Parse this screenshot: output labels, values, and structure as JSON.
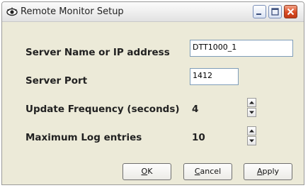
{
  "window": {
    "title": "Remote Monitor Setup",
    "app_icon": "eye-icon",
    "controls": [
      "minimize-icon",
      "maximize-icon",
      "close-icon"
    ],
    "close_color": "#d94a22"
  },
  "fields": {
    "server_name": {
      "label": "Server Name or IP address",
      "value": "DTT1000_1"
    },
    "server_port": {
      "label": "Server Port",
      "value": "1412"
    },
    "update_frequency": {
      "label": "Update Frequency (seconds)",
      "value": "4"
    },
    "max_log_entries": {
      "label": "Maximum Log entries",
      "value": "10"
    }
  },
  "buttons": {
    "ok": {
      "mnemonic": "O",
      "rest": "K"
    },
    "cancel": {
      "mnemonic": "C",
      "rest": "ancel"
    },
    "apply": {
      "mnemonic": "A",
      "rest": "pply"
    }
  }
}
